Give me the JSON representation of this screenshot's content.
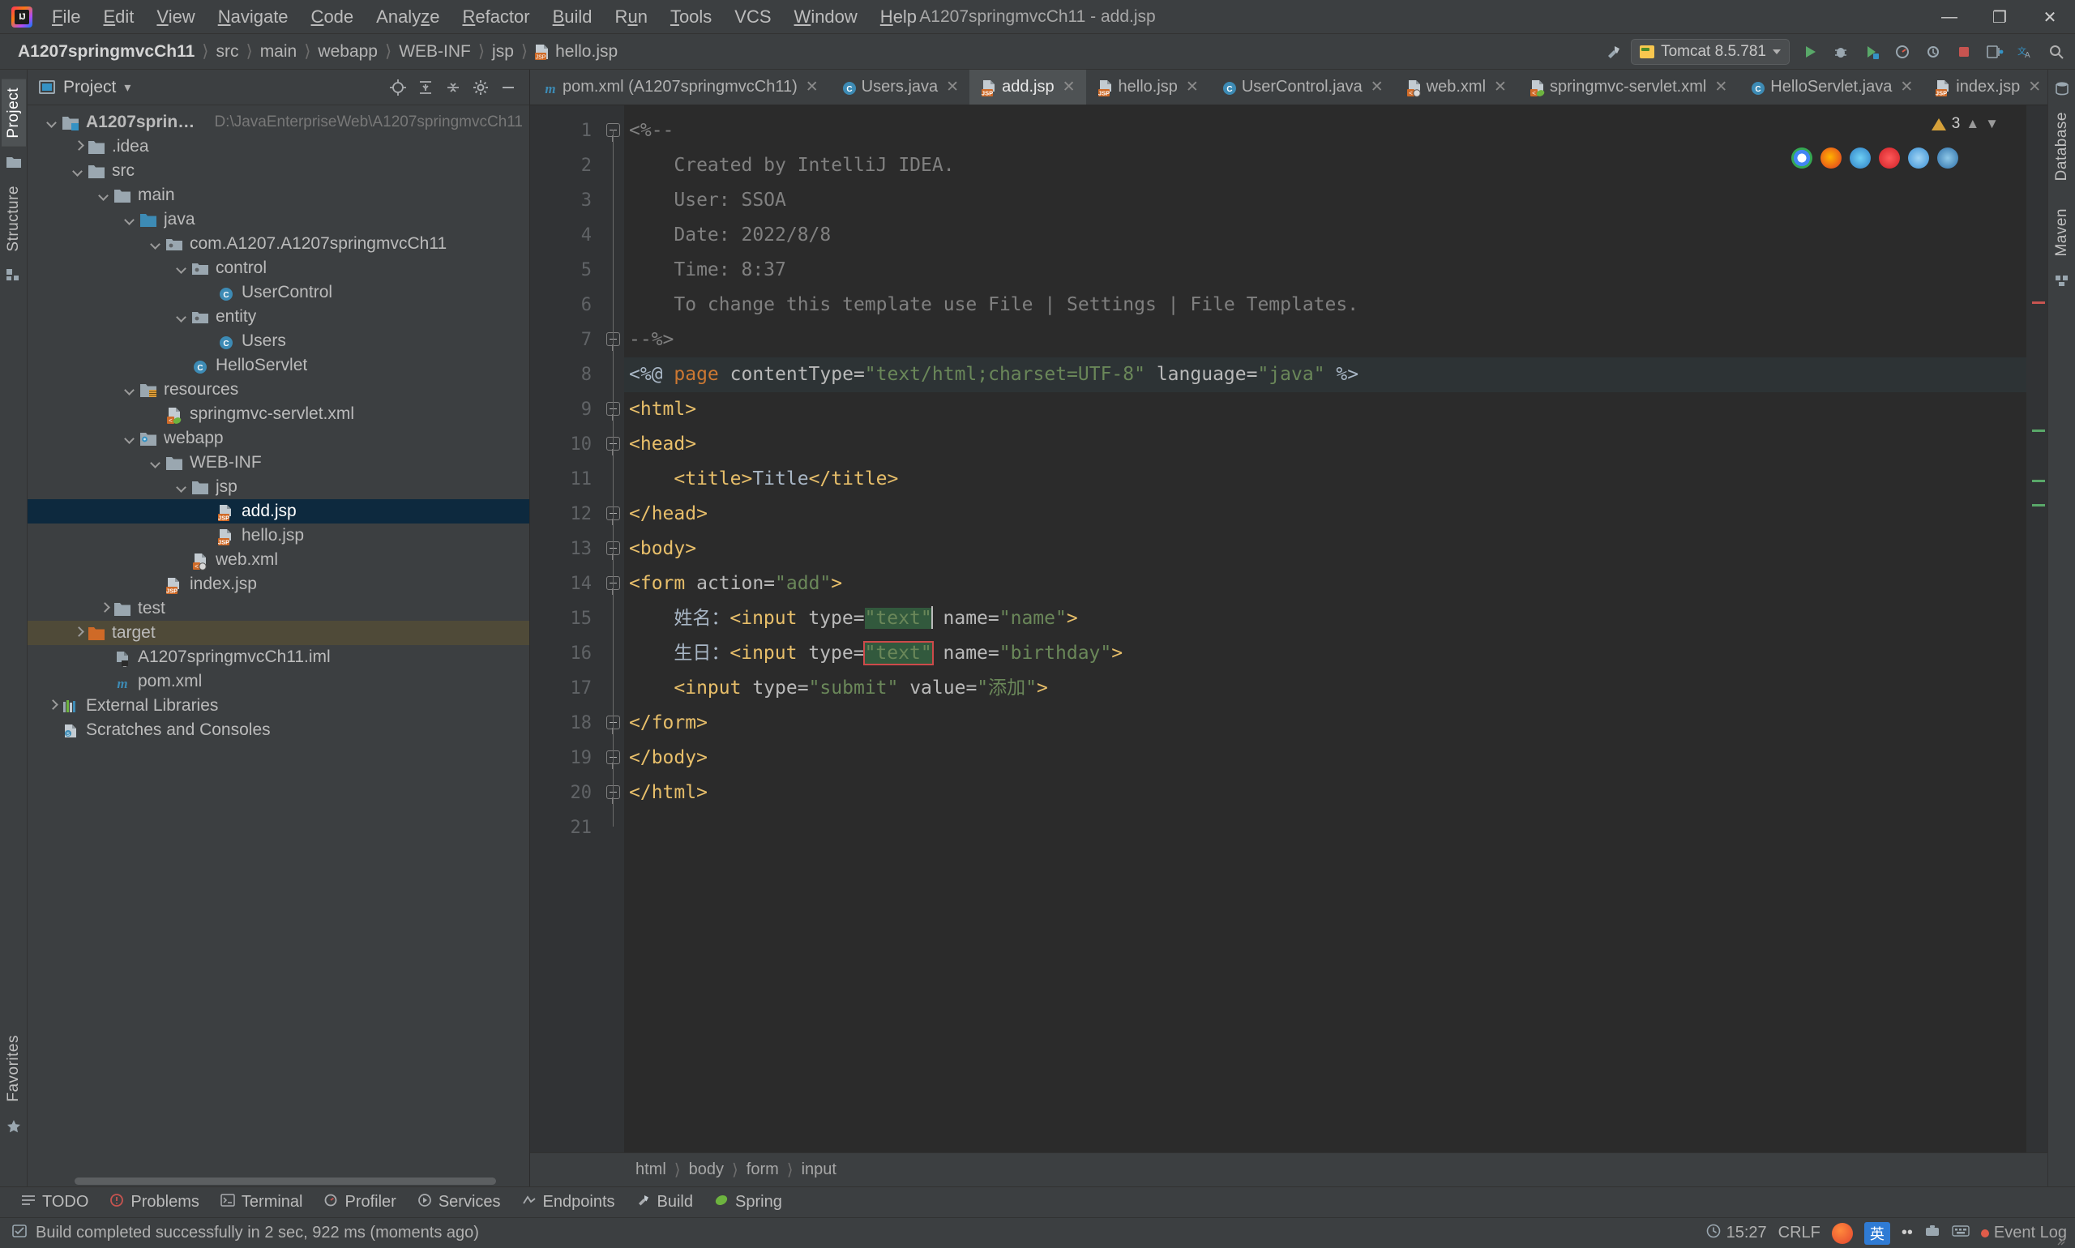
{
  "window": {
    "title": "A1207springmvcCh11 - add.jsp",
    "logo_text": "IJ",
    "minimize": "—",
    "maximize": "❐",
    "close": "✕"
  },
  "menubar": {
    "items": [
      {
        "label": "File",
        "mnemonic": "F"
      },
      {
        "label": "Edit",
        "mnemonic": "E"
      },
      {
        "label": "View",
        "mnemonic": "V"
      },
      {
        "label": "Navigate",
        "mnemonic": "N"
      },
      {
        "label": "Code",
        "mnemonic": "C"
      },
      {
        "label": "Analyze",
        "mnemonic": ""
      },
      {
        "label": "Refactor",
        "mnemonic": "R"
      },
      {
        "label": "Build",
        "mnemonic": "B"
      },
      {
        "label": "Run",
        "mnemonic": "u"
      },
      {
        "label": "Tools",
        "mnemonic": "T"
      },
      {
        "label": "VCS",
        "mnemonic": ""
      },
      {
        "label": "Window",
        "mnemonic": "W"
      },
      {
        "label": "Help",
        "mnemonic": "H"
      }
    ]
  },
  "navbar": {
    "crumbs": [
      "A1207springmvcCh11",
      "src",
      "main",
      "webapp",
      "WEB-INF",
      "jsp",
      "hello.jsp"
    ],
    "separator": "〉",
    "run_config": {
      "label": "Tomcat 8.5.781",
      "icon": "tomcat-icon"
    },
    "right_icons": [
      "hammer-build-icon",
      "run-icon",
      "debug-icon",
      "run-coverage-icon",
      "profiler-icon",
      "attach-icon",
      "stop-icon",
      "updates-icon",
      "translate-icon",
      "search-everywhere-icon"
    ]
  },
  "left_strip": {
    "tabs": [
      "Project",
      "Structure",
      "Favorites"
    ]
  },
  "right_strip": {
    "tabs": [
      "Database",
      "Maven"
    ]
  },
  "project_panel": {
    "title": "Project",
    "dropdown": "▾",
    "actions": [
      "locate-icon",
      "expand-all-icon",
      "collapse-all-icon",
      "settings-gear-icon",
      "hide-icon"
    ],
    "tree": [
      {
        "depth": 0,
        "arrow": "down",
        "icon": "project-folder",
        "label": "A1207springmvcCh11",
        "bold": true,
        "path": "D:\\JavaEnterpriseWeb\\A1207springmvcCh11",
        "state": "normal"
      },
      {
        "depth": 1,
        "arrow": "right",
        "icon": "folder",
        "label": ".idea",
        "state": "normal"
      },
      {
        "depth": 1,
        "arrow": "down",
        "icon": "folder",
        "label": "src",
        "state": "normal"
      },
      {
        "depth": 2,
        "arrow": "down",
        "icon": "folder",
        "label": "main",
        "state": "normal"
      },
      {
        "depth": 3,
        "arrow": "down",
        "icon": "folder-source",
        "label": "java",
        "state": "normal"
      },
      {
        "depth": 4,
        "arrow": "down",
        "icon": "package",
        "label": "com.A1207.A1207springmvcCh11",
        "state": "normal"
      },
      {
        "depth": 5,
        "arrow": "down",
        "icon": "package",
        "label": "control",
        "state": "normal"
      },
      {
        "depth": 6,
        "arrow": "none",
        "icon": "java-class",
        "label": "UserControl",
        "state": "normal"
      },
      {
        "depth": 5,
        "arrow": "down",
        "icon": "package",
        "label": "entity",
        "state": "normal"
      },
      {
        "depth": 6,
        "arrow": "none",
        "icon": "java-class",
        "label": "Users",
        "state": "normal"
      },
      {
        "depth": 5,
        "arrow": "none",
        "icon": "java-class",
        "label": "HelloServlet",
        "state": "normal"
      },
      {
        "depth": 3,
        "arrow": "down",
        "icon": "folder-resources",
        "label": "resources",
        "state": "normal"
      },
      {
        "depth": 4,
        "arrow": "none",
        "icon": "xml-spring-file",
        "label": "springmvc-servlet.xml",
        "state": "normal"
      },
      {
        "depth": 3,
        "arrow": "down",
        "icon": "folder-web",
        "label": "webapp",
        "state": "normal"
      },
      {
        "depth": 4,
        "arrow": "down",
        "icon": "folder",
        "label": "WEB-INF",
        "state": "normal"
      },
      {
        "depth": 5,
        "arrow": "down",
        "icon": "folder",
        "label": "jsp",
        "state": "normal"
      },
      {
        "depth": 6,
        "arrow": "none",
        "icon": "jsp-file",
        "label": "add.jsp",
        "state": "selected"
      },
      {
        "depth": 6,
        "arrow": "none",
        "icon": "jsp-file",
        "label": "hello.jsp",
        "state": "normal"
      },
      {
        "depth": 5,
        "arrow": "none",
        "icon": "xml-file",
        "label": "web.xml",
        "state": "normal"
      },
      {
        "depth": 4,
        "arrow": "none",
        "icon": "jsp-file",
        "label": "index.jsp",
        "state": "normal"
      },
      {
        "depth": 2,
        "arrow": "right",
        "icon": "folder",
        "label": "test",
        "state": "normal"
      },
      {
        "depth": 1,
        "arrow": "right",
        "icon": "folder-excluded",
        "label": "target",
        "state": "context"
      },
      {
        "depth": 2,
        "arrow": "none",
        "icon": "iml-file",
        "label": "A1207springmvcCh11.iml",
        "state": "normal"
      },
      {
        "depth": 2,
        "arrow": "none",
        "icon": "maven-file",
        "label": "pom.xml",
        "state": "normal"
      },
      {
        "depth": 0,
        "arrow": "right",
        "icon": "libraries",
        "label": "External Libraries",
        "state": "normal"
      },
      {
        "depth": 0,
        "arrow": "none",
        "icon": "scratches",
        "label": "Scratches and Consoles",
        "state": "normal"
      }
    ]
  },
  "editor_tabs": [
    {
      "label": "pom.xml (A1207springmvcCh11)",
      "icon": "maven-file",
      "active": false
    },
    {
      "label": "Users.java",
      "icon": "java-class",
      "active": false
    },
    {
      "label": "add.jsp",
      "icon": "jsp-file",
      "active": true
    },
    {
      "label": "hello.jsp",
      "icon": "jsp-file",
      "active": false
    },
    {
      "label": "UserControl.java",
      "icon": "java-class",
      "active": false
    },
    {
      "label": "web.xml",
      "icon": "xml-file",
      "active": false
    },
    {
      "label": "springmvc-servlet.xml",
      "icon": "xml-spring-file",
      "active": false
    },
    {
      "label": "HelloServlet.java",
      "icon": "java-class",
      "active": false
    },
    {
      "label": "index.jsp",
      "icon": "jsp-file",
      "active": false
    }
  ],
  "editor": {
    "close_glyph": "✕",
    "inspection": {
      "count": "3",
      "icon": "warning-triangle"
    },
    "line_numbers": [
      "1",
      "2",
      "3",
      "4",
      "5",
      "6",
      "7",
      "8",
      "9",
      "10",
      "11",
      "12",
      "13",
      "14",
      "15",
      "16",
      "17",
      "18",
      "19",
      "20",
      "21"
    ],
    "lines": [
      {
        "n": 1,
        "segments": [
          {
            "t": "<%--",
            "c": "c-comment"
          }
        ]
      },
      {
        "n": 2,
        "segments": [
          {
            "t": "    Created by IntelliJ IDEA.",
            "c": "c-comment"
          }
        ]
      },
      {
        "n": 3,
        "segments": [
          {
            "t": "    User: SSOA",
            "c": "c-comment"
          }
        ]
      },
      {
        "n": 4,
        "segments": [
          {
            "t": "    Date: 2022/8/8",
            "c": "c-comment"
          }
        ]
      },
      {
        "n": 5,
        "segments": [
          {
            "t": "    Time: 8:37",
            "c": "c-comment"
          }
        ]
      },
      {
        "n": 6,
        "segments": [
          {
            "t": "    To change this template use File | Settings | File Templates.",
            "c": "c-comment"
          }
        ]
      },
      {
        "n": 7,
        "segments": [
          {
            "t": "--%>",
            "c": "c-comment"
          }
        ]
      },
      {
        "n": 8,
        "segments": [
          {
            "t": "<%@ ",
            "c": "c-punc"
          },
          {
            "t": "page",
            "c": "c-kw"
          },
          {
            "t": " contentType=",
            "c": "c-attr"
          },
          {
            "t": "\"text/html;charset=UTF-8\"",
            "c": "c-str"
          },
          {
            "t": " language=",
            "c": "c-attr"
          },
          {
            "t": "\"java\"",
            "c": "c-str"
          },
          {
            "t": " %>",
            "c": "c-punc"
          }
        ]
      },
      {
        "n": 9,
        "segments": [
          {
            "t": "<html>",
            "c": "c-tag"
          }
        ]
      },
      {
        "n": 10,
        "segments": [
          {
            "t": "<head>",
            "c": "c-tag"
          }
        ]
      },
      {
        "n": 11,
        "segments": [
          {
            "t": "    <title>",
            "c": "c-tag"
          },
          {
            "t": "Title",
            "c": "c-txt"
          },
          {
            "t": "</title>",
            "c": "c-tag"
          }
        ]
      },
      {
        "n": 12,
        "segments": [
          {
            "t": "</head>",
            "c": "c-tag"
          }
        ]
      },
      {
        "n": 13,
        "segments": [
          {
            "t": "<body>",
            "c": "c-tag"
          }
        ]
      },
      {
        "n": 14,
        "segments": [
          {
            "t": "<form ",
            "c": "c-tag"
          },
          {
            "t": "action=",
            "c": "c-attr"
          },
          {
            "t": "\"add\"",
            "c": "c-str"
          },
          {
            "t": ">",
            "c": "c-tag"
          }
        ]
      },
      {
        "n": 15,
        "segments": [
          {
            "t": "    姓名：",
            "c": "c-txt"
          },
          {
            "t": "<input ",
            "c": "c-tag"
          },
          {
            "t": "type=",
            "c": "c-attr"
          },
          {
            "t": "\"text\"",
            "c": "c-str",
            "mark": "selection"
          },
          {
            "t": " name=",
            "c": "c-attr"
          },
          {
            "t": "\"name\"",
            "c": "c-str"
          },
          {
            "t": ">",
            "c": "c-tag"
          }
        ]
      },
      {
        "n": 16,
        "segments": [
          {
            "t": "    生日：",
            "c": "c-txt"
          },
          {
            "t": "<input ",
            "c": "c-tag"
          },
          {
            "t": "type=",
            "c": "c-attr"
          },
          {
            "t": "\"text\"",
            "c": "c-str",
            "mark": "search"
          },
          {
            "t": " name=",
            "c": "c-attr"
          },
          {
            "t": "\"birthday\"",
            "c": "c-str"
          },
          {
            "t": ">",
            "c": "c-tag"
          }
        ]
      },
      {
        "n": 17,
        "segments": [
          {
            "t": "    <input ",
            "c": "c-tag"
          },
          {
            "t": "type=",
            "c": "c-attr"
          },
          {
            "t": "\"submit\"",
            "c": "c-str"
          },
          {
            "t": " value=",
            "c": "c-attr"
          },
          {
            "t": "\"添加\"",
            "c": "c-str"
          },
          {
            "t": ">",
            "c": "c-tag"
          }
        ]
      },
      {
        "n": 18,
        "segments": [
          {
            "t": "</form>",
            "c": "c-tag"
          }
        ]
      },
      {
        "n": 19,
        "segments": [
          {
            "t": "</body>",
            "c": "c-tag"
          }
        ]
      },
      {
        "n": 20,
        "segments": [
          {
            "t": "</html>",
            "c": "c-tag"
          }
        ]
      },
      {
        "n": 21,
        "segments": [
          {
            "t": "",
            "c": "c-txt"
          }
        ]
      }
    ],
    "structure_crumbs": [
      "html",
      "body",
      "form",
      "input"
    ]
  },
  "bottom_bar": {
    "buttons": [
      {
        "label": "TODO",
        "icon": "todo-icon"
      },
      {
        "label": "Problems",
        "icon": "problems-icon"
      },
      {
        "label": "Terminal",
        "icon": "terminal-icon"
      },
      {
        "label": "Profiler",
        "icon": "profiler-icon"
      },
      {
        "label": "Services",
        "icon": "services-icon"
      },
      {
        "label": "Endpoints",
        "icon": "endpoints-icon"
      },
      {
        "label": "Build",
        "icon": "build-icon"
      },
      {
        "label": "Spring",
        "icon": "spring-icon"
      }
    ]
  },
  "statusbar": {
    "message": "Build completed successfully in 2 sec, 922 ms (moments ago)",
    "message_icon": "build-status-icon",
    "time": "15:27",
    "line_sep": "CRLF",
    "ime_label": "英",
    "event_log": "Event Log",
    "event_log_icon": "notification-dot"
  },
  "colors": {
    "accent_blue": "#3592c4",
    "selection_blue": "#0d293e",
    "context_tan": "#4f4a38",
    "editor_bg": "#2b2b2b",
    "panel_bg": "#3c3f41",
    "gutter_bg": "#313335",
    "string_green": "#6a8759",
    "keyword_orange": "#cc7832",
    "tag_yellow": "#e8bf6a",
    "comment_gray": "#808080",
    "search_outline_red": "#cc4a4a",
    "jsp_orange": "#cf6a27"
  }
}
